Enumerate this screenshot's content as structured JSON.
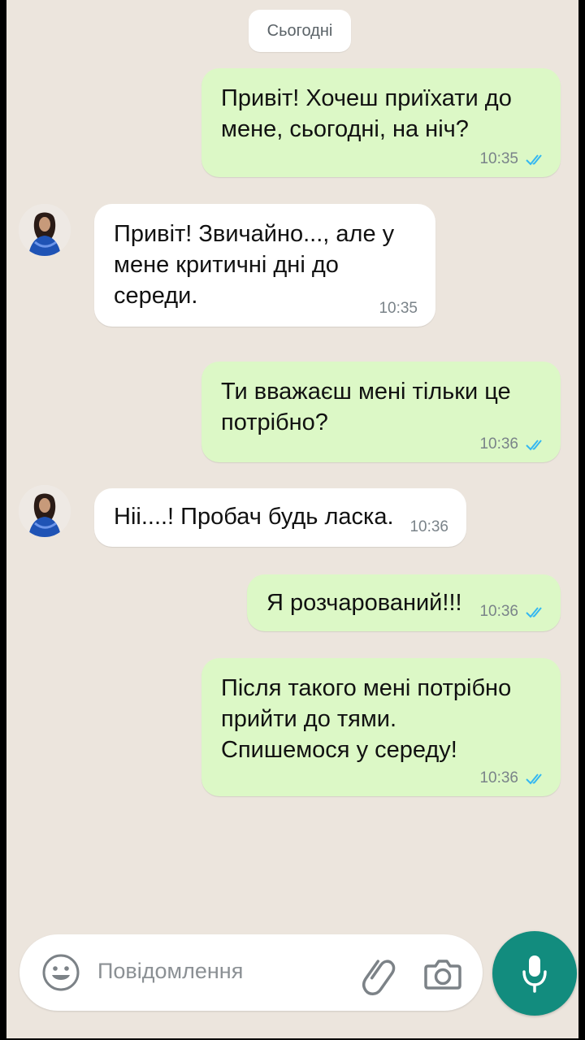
{
  "date_separator": "Сьогодні",
  "messages": [
    {
      "direction": "out",
      "text": "Привіт! Хочеш приїхати до\nмене, сьогодні, на ніч?",
      "time": "10:35",
      "read": true
    },
    {
      "direction": "in",
      "text": "Привіт! Звичайно..., але у\nмене критичні дні до\nсереди.",
      "time": "10:35"
    },
    {
      "direction": "out",
      "text": "Ти вважаєш мені тільки це\nпотрібно?",
      "time": "10:36",
      "read": true
    },
    {
      "direction": "in",
      "text": "Ніі....! Пробач будь ласка.",
      "time": "10:36"
    },
    {
      "direction": "out",
      "text": "Я розчарований!!!",
      "time": "10:36",
      "read": true
    },
    {
      "direction": "out",
      "text": "Після такого мені потрібно\nприйти до тями.\nСпишемося у середу!",
      "time": "10:36",
      "read": true
    }
  ],
  "composer": {
    "placeholder": "Повідомлення",
    "emoji_icon": "emoji-icon",
    "attach_icon": "paperclip-icon",
    "camera_icon": "camera-icon",
    "mic_icon": "microphone-icon"
  },
  "colors": {
    "chat_background": "#ece5dd",
    "outgoing_bubble": "#dcf8c6",
    "incoming_bubble": "#ffffff",
    "read_check": "#34b7f1",
    "mic_button": "#128c7e"
  }
}
